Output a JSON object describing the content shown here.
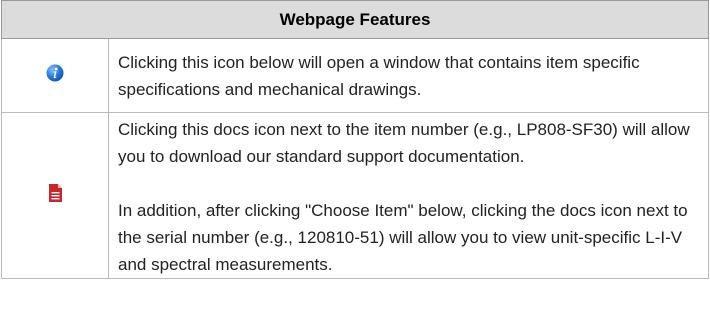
{
  "table": {
    "header": "Webpage Features",
    "rows": [
      {
        "icon": "info-icon",
        "text": "Clicking this icon below will open a window that contains item specific specifications and mechanical drawings."
      },
      {
        "icon": "document-icon",
        "paragraphs": [
          "Clicking this docs icon next to the item number (e.g., LP808-SF30) will allow you to download our standard support documentation.",
          "In addition, after clicking \"Choose Item\" below, clicking the docs icon next to the serial number (e.g., 120810-51) will allow you to view unit-specific L-I-V and spectral measurements."
        ]
      }
    ]
  },
  "colors": {
    "header_bg": "#dcdcdc",
    "border": "#bbbbbb",
    "info_icon": "#1d6fd1",
    "doc_icon": "#c9252b"
  }
}
